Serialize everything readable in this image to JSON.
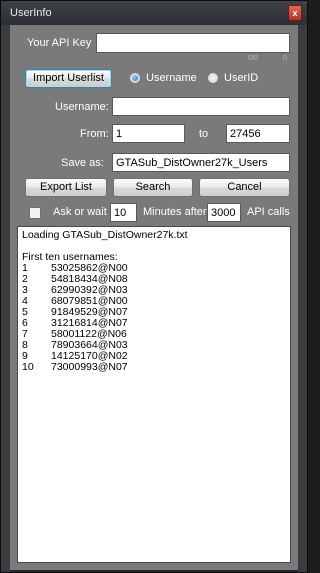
{
  "window": {
    "title": "UserInfo",
    "close_glyph": "x"
  },
  "api": {
    "label": "Your API Key",
    "value": "",
    "quota_text": "0/0",
    "quota_count": "0"
  },
  "import": {
    "button_label": "Import Userlist",
    "radio_username": "Username",
    "radio_userid": "UserID",
    "selected": "Username"
  },
  "username": {
    "label": "Username:",
    "value": ""
  },
  "range": {
    "from_label": "From:",
    "from_value": "1",
    "to_label": "to",
    "to_value": "27456"
  },
  "save": {
    "label": "Save as:",
    "value": "GTASub_DistOwner27k_Users"
  },
  "actions": {
    "export_label": "Export List",
    "search_label": "Search",
    "cancel_label": "Cancel"
  },
  "wait": {
    "checkbox_label": "Ask or wait",
    "checked": false,
    "minutes_value": "10",
    "minutes_label": "Minutes after",
    "calls_value": "3000",
    "calls_label": "API calls"
  },
  "log": {
    "loading": "Loading GTASub_DistOwner27k.txt",
    "header": "First ten usernames:",
    "entries": [
      {
        "n": "1",
        "v": "53025862@N00"
      },
      {
        "n": "2",
        "v": "54818434@N08"
      },
      {
        "n": "3",
        "v": "62990392@N03"
      },
      {
        "n": "4",
        "v": "68079851@N00"
      },
      {
        "n": "5",
        "v": "91849529@N07"
      },
      {
        "n": "6",
        "v": "31216814@N07"
      },
      {
        "n": "7",
        "v": "58001122@N06"
      },
      {
        "n": "8",
        "v": "78903664@N03"
      },
      {
        "n": "9",
        "v": "14125170@N02"
      },
      {
        "n": "10",
        "v": "73000993@N07"
      }
    ]
  },
  "colors": {
    "client_bg": "#7a7a7a",
    "frame": "#3a3d40",
    "accent_radio": "#1e6fc1",
    "close_button": "#c43c2f"
  }
}
